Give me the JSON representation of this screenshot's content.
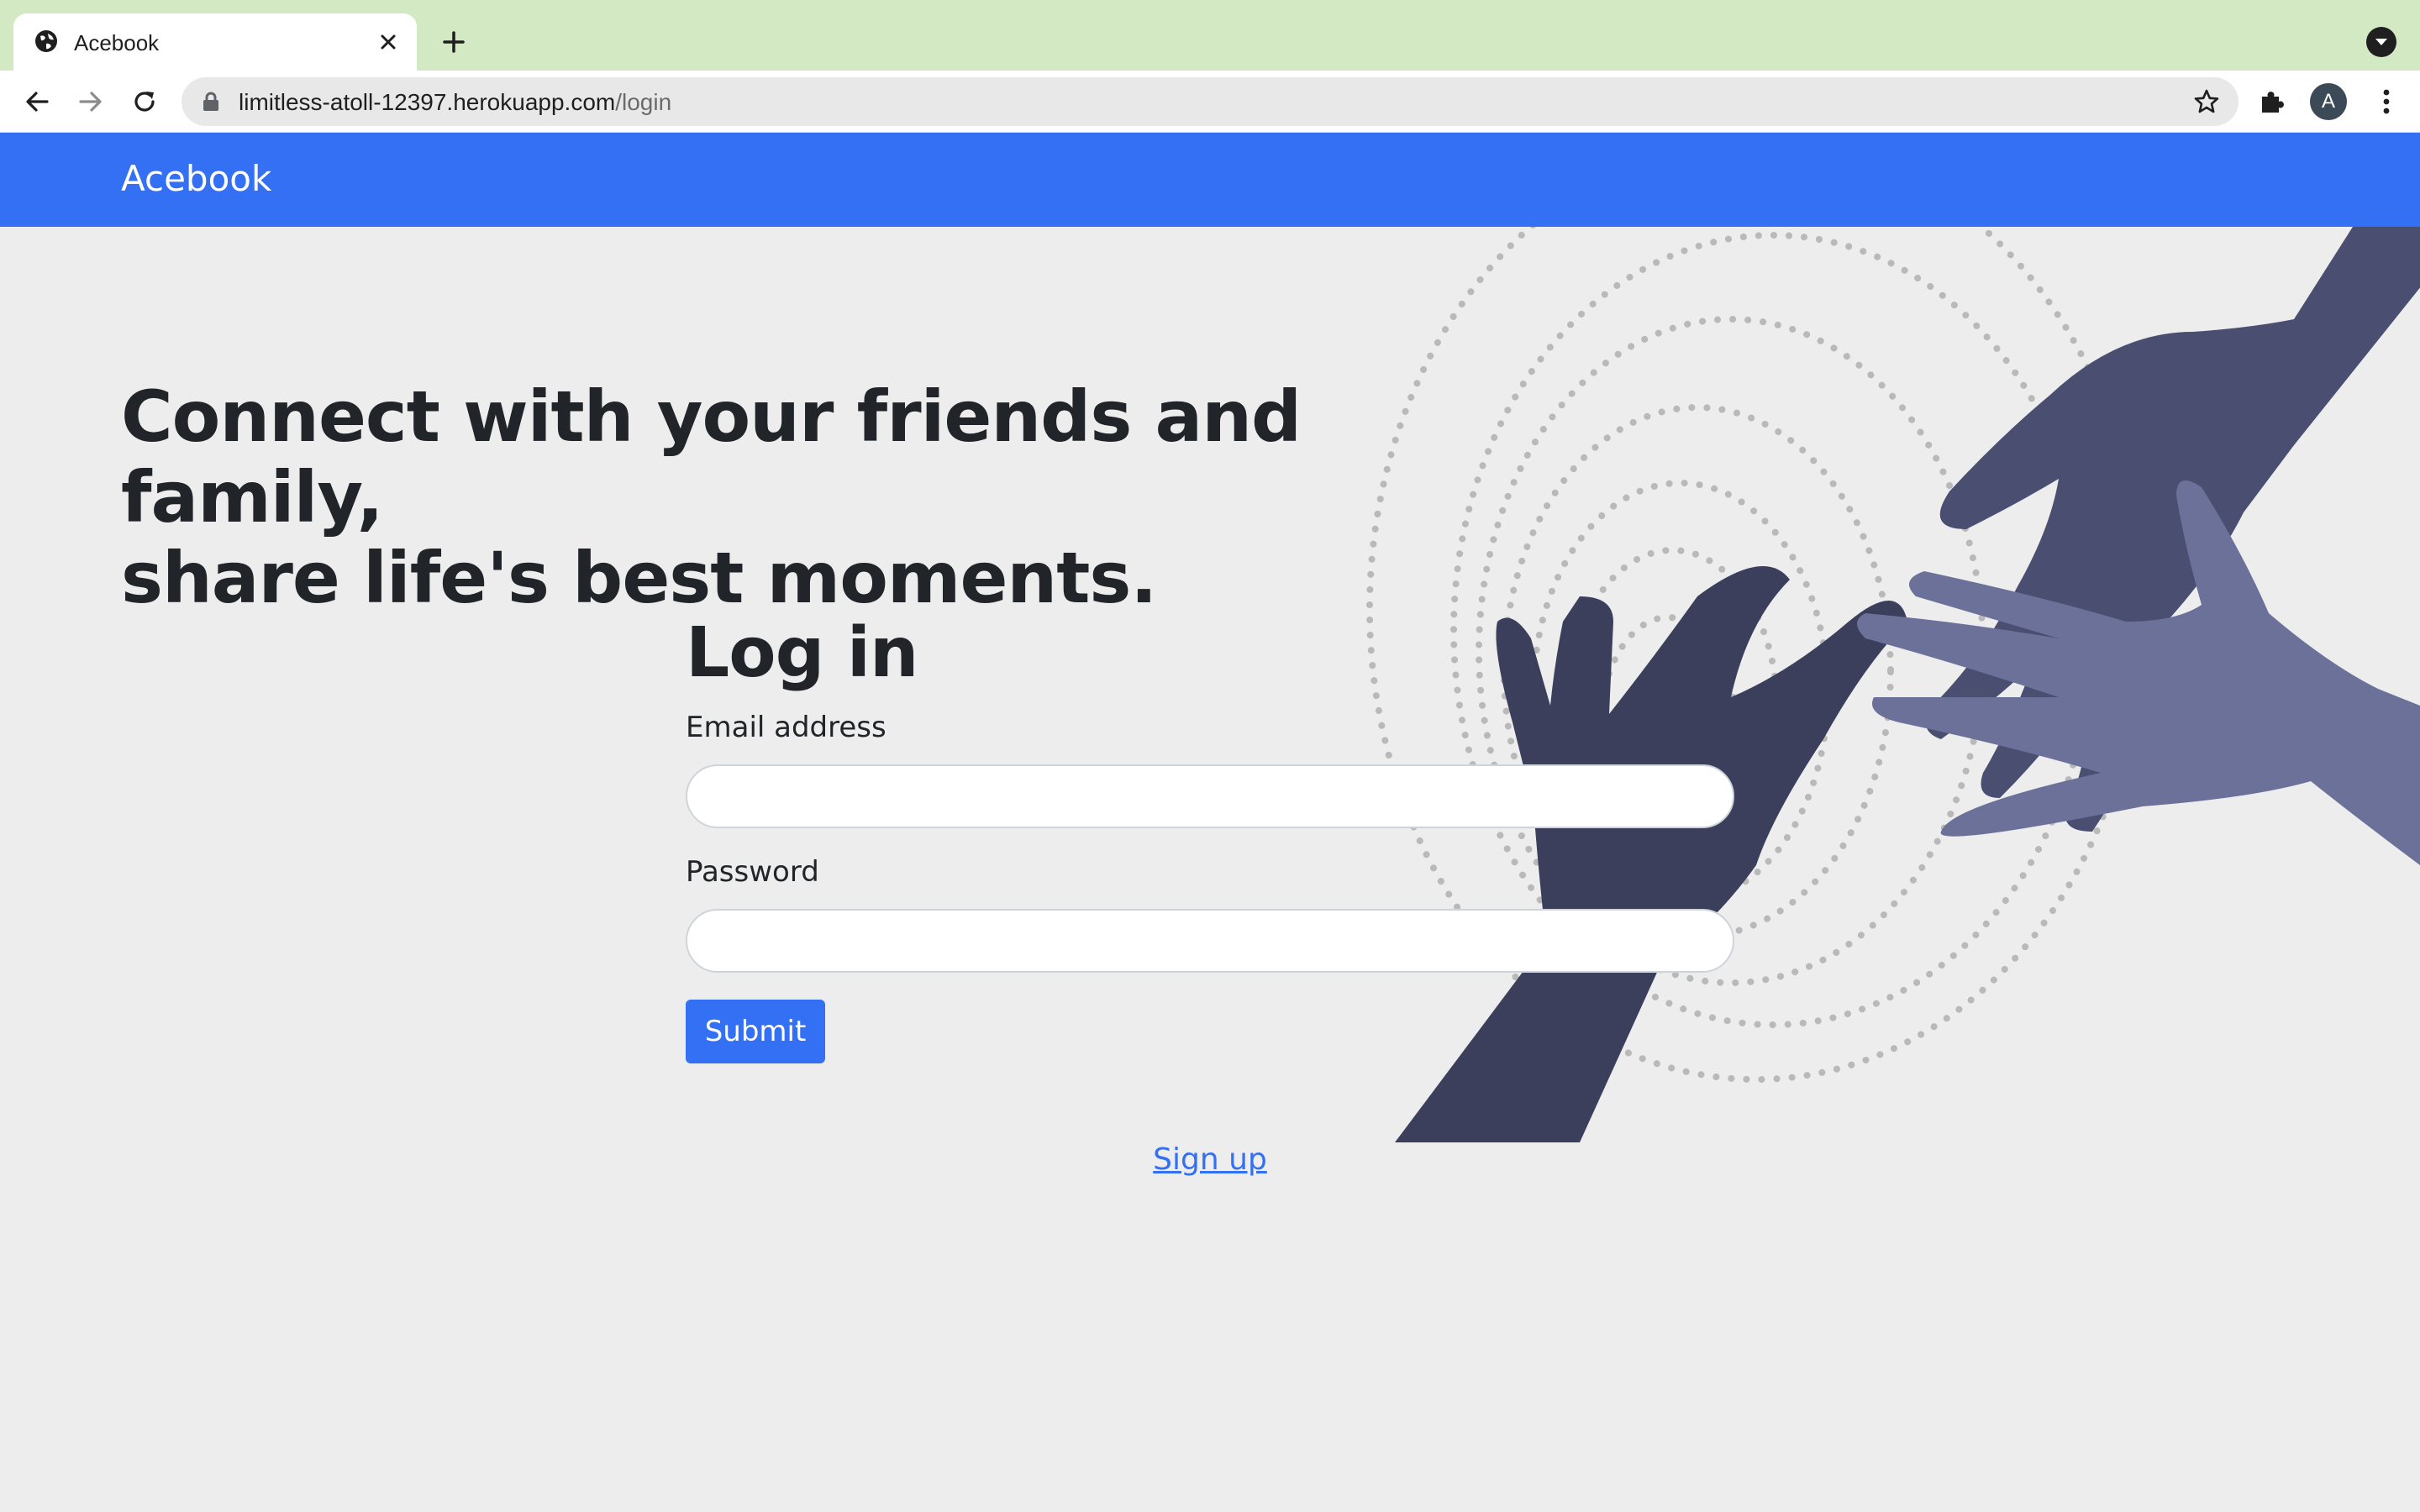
{
  "browser": {
    "tab": {
      "title": "Acebook",
      "favicon": "globe-icon"
    },
    "url": {
      "host": "limitless-atoll-12397.herokuapp.com",
      "path": "/login"
    },
    "profile_initial": "A",
    "icons": [
      "globe-icon",
      "close-icon",
      "plus-icon",
      "chevron-down-icon",
      "back-arrow-icon",
      "forward-arrow-icon",
      "reload-icon",
      "lock-icon",
      "star-icon",
      "puzzle-icon",
      "more-vertical-icon"
    ],
    "colors": {
      "tabstrip": "#d3e9c4",
      "toolbar": "#ffffff",
      "omnibox": "#e8e8e8"
    }
  },
  "navbar": {
    "brand": "Acebook"
  },
  "hero": {
    "headline_line1": "Connect with your friends and family,",
    "headline_line2": "share life's best moments.",
    "illustration": "reaching-hands-illustration"
  },
  "login": {
    "title": "Log in",
    "email_label": "Email address",
    "email_value": "",
    "password_label": "Password",
    "password_value": "",
    "submit_label": "Submit"
  },
  "footer": {
    "signup_link": "Sign up"
  },
  "colors": {
    "primary": "#3470f4",
    "background": "#ededed",
    "text": "#212529",
    "hand_dark": "#3b3f5c",
    "hand_mid": "#4e5278",
    "hand_light": "#6b7199",
    "dots": "#b9b9b9"
  }
}
